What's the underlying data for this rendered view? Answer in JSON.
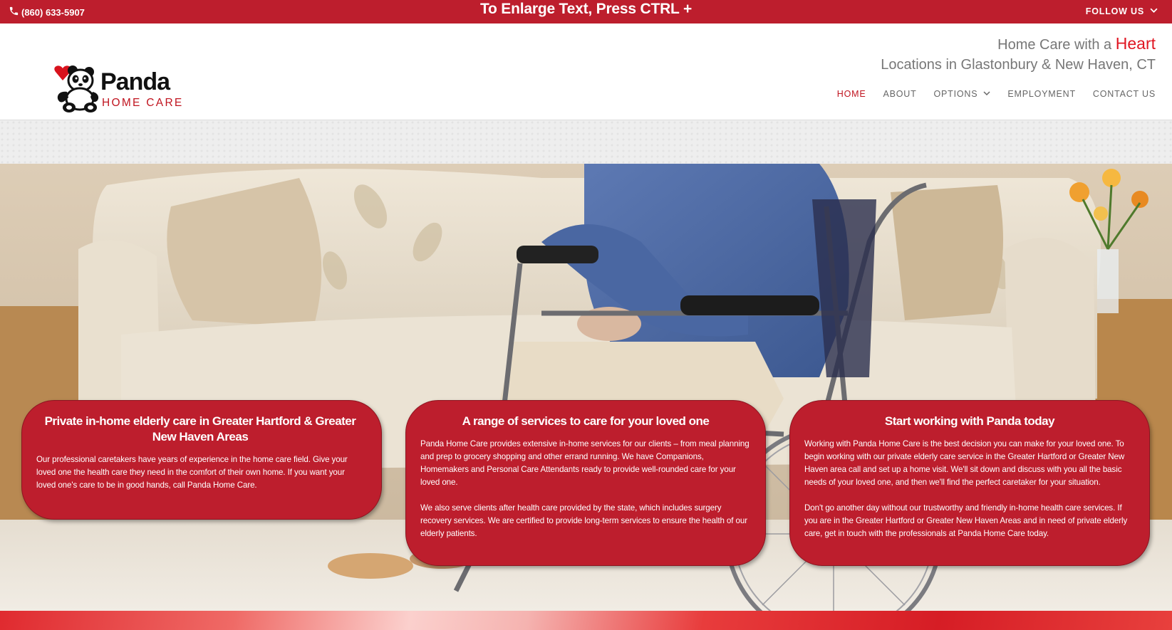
{
  "topbar": {
    "phone": "(860) 633-5907",
    "enlarge_notice": "To Enlarge Text, Press CTRL +",
    "follow_label": "FOLLOW US"
  },
  "header": {
    "logo": {
      "brand": "Panda",
      "sub": "HOME CARE"
    },
    "tagline_prefix": "Home Care with a",
    "tagline_heart": "Heart",
    "locations": "Locations in Glastonbury & New Haven, CT",
    "nav": [
      {
        "label": "HOME",
        "active": true
      },
      {
        "label": "ABOUT"
      },
      {
        "label": "OPTIONS",
        "dropdown": true
      },
      {
        "label": "EMPLOYMENT"
      },
      {
        "label": "CONTACT US"
      }
    ]
  },
  "cards": [
    {
      "title": "Private in-home elderly care in Greater Hartford & Greater New Haven Areas",
      "paragraphs": [
        "Our professional caretakers have years of experience in the home care field. Give your loved one the health care they need in the comfort of their own home. If you want your loved one's care to be in good hands, call Panda Home Care."
      ]
    },
    {
      "title": "A range of services to care for your loved one",
      "paragraphs": [
        "Panda Home Care provides extensive in-home services for our clients – from meal planning and prep to grocery shopping and other errand running. We have Companions, Homemakers and Personal Care Attendants ready to provide well-rounded care for your loved one.",
        "We also serve clients after health care provided by the state, which includes surgery recovery services. We are certified to provide long-term services to ensure the health of our elderly patients."
      ]
    },
    {
      "title": "Start working with Panda today",
      "paragraphs": [
        "Working with Panda Home Care is the best decision you can make for your loved one. To begin working with our private elderly care service in the Greater Hartford or Greater New Haven area call and set up a home visit. We'll sit down and discuss with you all the basic needs of your loved one, and then we'll find the perfect caretaker for your situation.",
        "Don't go another day without our trustworthy and friendly in-home health care services. If you are in the Greater Hartford or Greater New Haven Areas and in need of private elderly care, get in touch with the professionals at Panda Home Care today."
      ]
    }
  ],
  "colors": {
    "brand_red": "#bd1e2d",
    "heart_red": "#e01622",
    "nav_gray": "#666666"
  },
  "icons": {
    "phone": "phone-icon",
    "follow_chevron": "chevron-down-icon",
    "options_chevron": "chevron-down-icon",
    "logo": "panda-logo-icon"
  }
}
